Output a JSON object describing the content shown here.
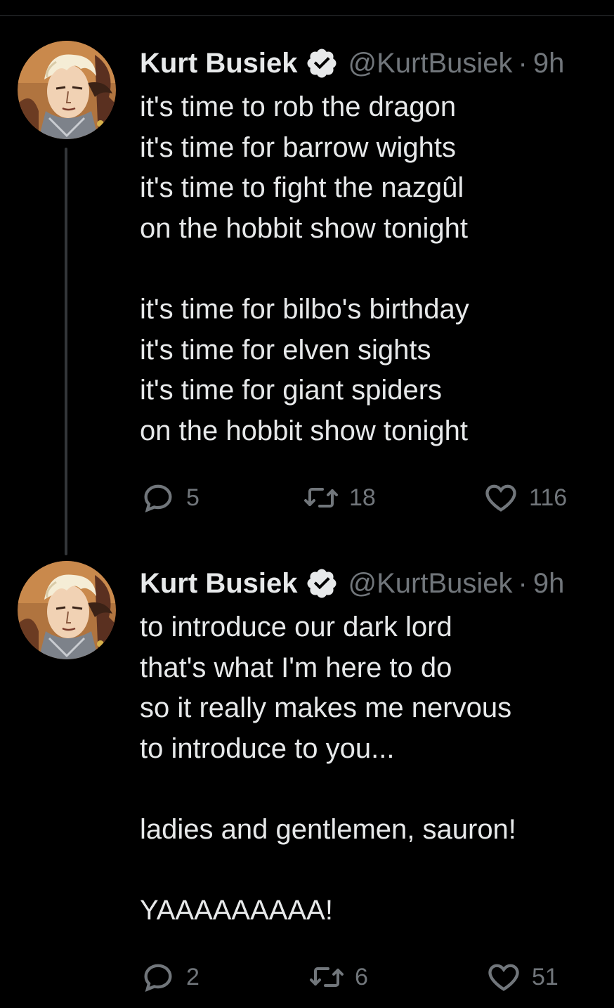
{
  "tweets": [
    {
      "author_name": "Kurt Busiek",
      "handle": "@KurtBusiek",
      "separator": "·",
      "time": "9h",
      "lines": [
        "it's time to rob the dragon",
        "it's time for barrow wights",
        "it's time to fight the nazgûl",
        "on the hobbit show tonight",
        "",
        "it's time for bilbo's birthday",
        "it's time for elven sights",
        "it's time for giant spiders",
        "on the hobbit show tonight"
      ],
      "replies": "5",
      "retweets": "18",
      "likes": "116"
    },
    {
      "author_name": "Kurt Busiek",
      "handle": "@KurtBusiek",
      "separator": "·",
      "time": "9h",
      "lines": [
        "to introduce our dark lord",
        "that's what I'm here to do",
        "so it really makes me nervous",
        "to introduce to you...",
        "",
        "ladies and gentlemen, sauron!",
        "",
        "YAAAAAAAAA!"
      ],
      "replies": "2",
      "retweets": "6",
      "likes": "51"
    }
  ],
  "icons": {
    "verified": "verified-badge-icon",
    "reply": "reply-bubble-icon",
    "retweet": "retweet-arrows-icon",
    "like": "heart-outline-icon"
  },
  "colors": {
    "background": "#000000",
    "text": "#e7e9ea",
    "muted": "#71767b",
    "thread_line": "#333639"
  }
}
